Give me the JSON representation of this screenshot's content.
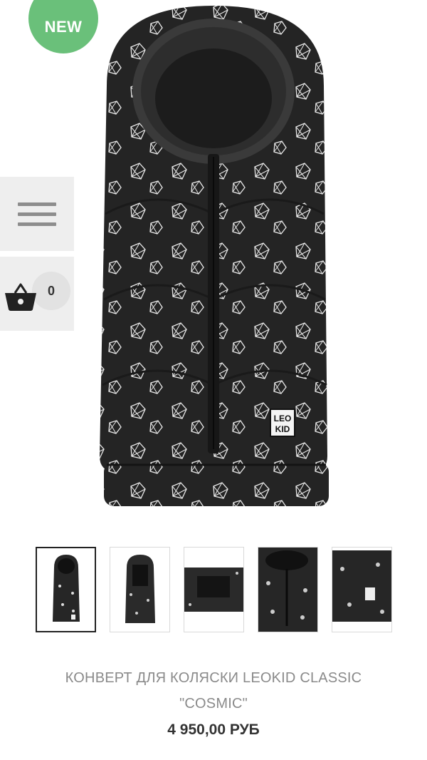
{
  "badge": {
    "label": "NEW",
    "color": "#6ac07a"
  },
  "menu": {
    "icon": "hamburger-menu-icon"
  },
  "cart": {
    "icon": "basket-icon",
    "count": "0"
  },
  "product": {
    "title": "КОНВЕРТ ДЛЯ КОЛЯСКИ LEOKID CLASSIC \"COSMIC\"",
    "price": "4 950,00 РУБ",
    "brand_tag": [
      "LEO",
      "KID"
    ]
  },
  "gallery": {
    "thumbnail_count": 5,
    "selected_index": 0
  },
  "colors": {
    "product_body": "#242424",
    "accent": "#6ac07a"
  }
}
